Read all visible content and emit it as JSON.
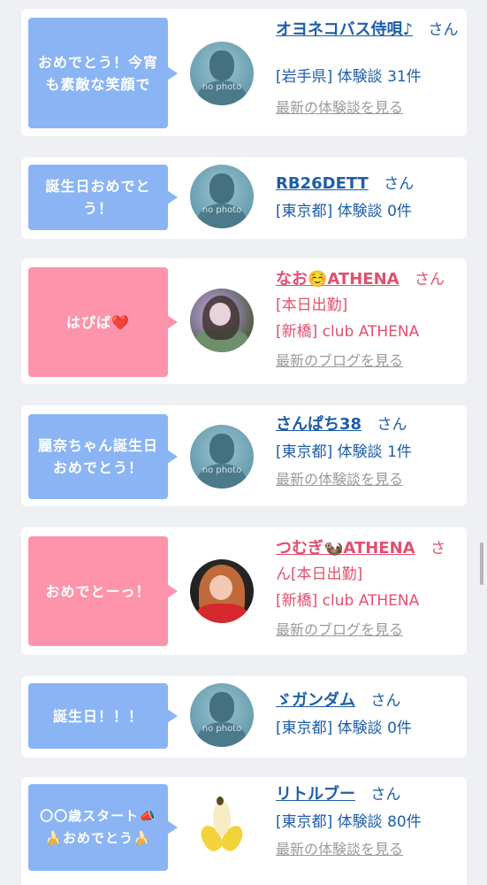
{
  "cards": [
    {
      "message": "おめでとう！今宵も素敵な笑顔で",
      "user": "オヨネコバス侍唄♪",
      "suffix": "さん",
      "meta1": "[岩手県] 体験談 31件",
      "link": "最新の体験談を見る",
      "avatar": "no photo"
    },
    {
      "message": "誕生日おめでとう！",
      "user": "RB26DETT",
      "suffix": "さん",
      "meta1": "[東京都] 体験談 0件",
      "avatar": "no photo"
    },
    {
      "message": "はぴば❤️",
      "user": "なお☺️ATHENA",
      "suffix": "さん",
      "meta1": "[本日出勤]",
      "meta2": "[新橋] club ATHENA",
      "link": "最新のブログを見る"
    },
    {
      "message": "麗奈ちゃん誕生日おめでとう！",
      "user": "さんぱち38",
      "suffix": "さん",
      "meta1": "[東京都] 体験談 1件",
      "link": "最新の体験談を見る",
      "avatar": "no photo"
    },
    {
      "message": "おめでとーっ！",
      "user": "つむぎ🦦ATHENA",
      "suffix": "さ",
      "meta1": "ん[本日出勤]",
      "meta2": "[新橋] club ATHENA",
      "link": "最新のブログを見る"
    },
    {
      "message": "誕生日！！！",
      "user": "ゞガンダム",
      "suffix": "さん",
      "meta1": "[東京都] 体験談 0件",
      "avatar": "no photo"
    },
    {
      "message": "〇〇歳スタート📣🍌おめでとう🍌",
      "user": "リトルブー",
      "suffix": "さん",
      "meta1": "[東京都] 体験談 80件",
      "link": "最新の体験談を見る"
    }
  ]
}
